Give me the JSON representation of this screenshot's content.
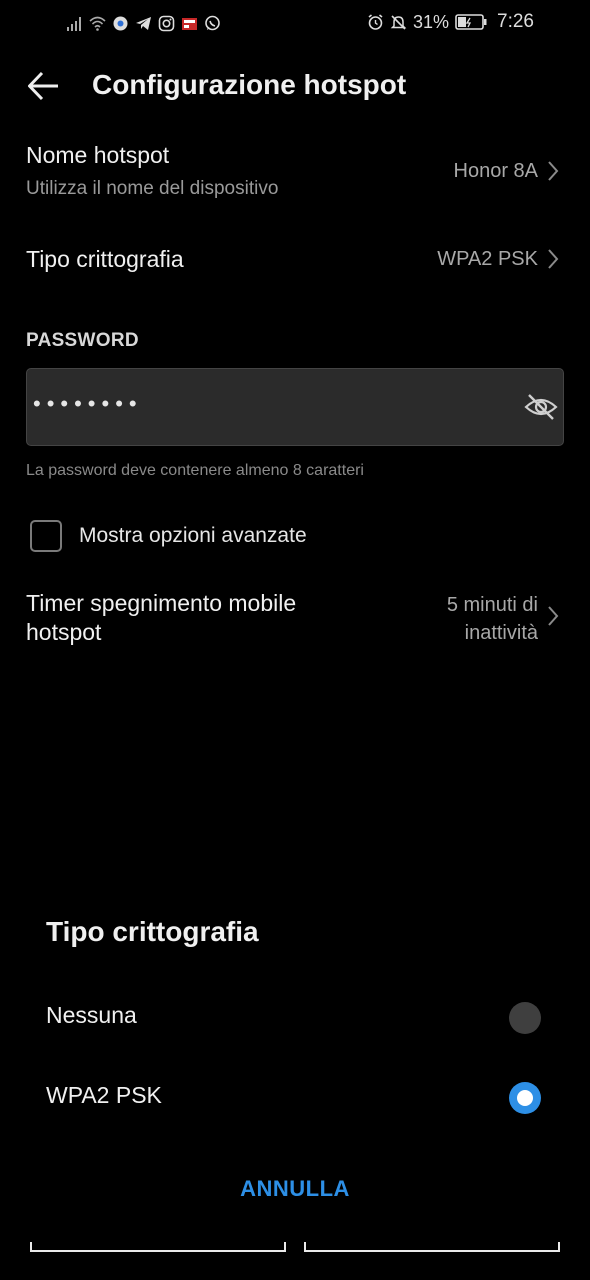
{
  "status_bar": {
    "left_icons": [
      "signal-icon",
      "wifi-icon",
      "vpn-icon",
      "telegram-icon",
      "instagram-icon",
      "news-icon",
      "whatsapp-icon"
    ],
    "right_icons": [
      "alarm-icon",
      "mute-notifications-icon"
    ],
    "battery_percent": "31%",
    "time": "7:26"
  },
  "app_bar": {
    "title": "Configurazione hotspot"
  },
  "settings": {
    "hotspot_name": {
      "label": "Nome hotspot",
      "sub": "Utilizza il nome del dispositivo",
      "value": "Honor 8A"
    },
    "encryption": {
      "label": "Tipo crittografia",
      "value": "WPA2 PSK"
    },
    "password_section": "PASSWORD",
    "password_masked": "••••••••",
    "password_hint": "La password deve contenere almeno 8 caratteri",
    "advanced_label": "Mostra opzioni avanzate",
    "timer": {
      "label_line1": "Timer spegnimento mobile",
      "label_line2": "hotspot",
      "value_line1": "5 minuti di",
      "value_line2": "inattività"
    }
  },
  "sheet": {
    "title": "Tipo crittografia",
    "options": [
      {
        "label": "Nessuna",
        "selected": false
      },
      {
        "label": "WPA2 PSK",
        "selected": true
      }
    ],
    "cancel_label": "ANNULLA"
  },
  "colors": {
    "accent": "#2d8fe6",
    "background": "#000000"
  }
}
